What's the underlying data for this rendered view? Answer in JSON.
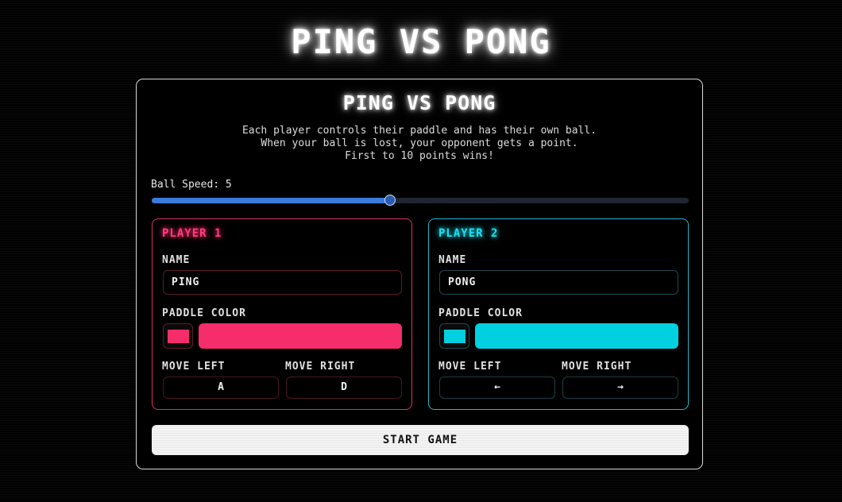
{
  "page_title": "PING VS PONG",
  "panel": {
    "title": "PING VS PONG",
    "instructions": [
      "Each player controls their paddle and has their own ball.",
      "When your ball is lost, your opponent gets a point.",
      "First to 10 points wins!"
    ]
  },
  "speed": {
    "label": "Ball Speed: 5",
    "value": 5,
    "min": 1,
    "max": 10,
    "fill_color": "#3a7bdc"
  },
  "player1": {
    "title": "PLAYER 1",
    "name_label": "NAME",
    "name_value": "PING",
    "paddle_color_label": "PADDLE COLOR",
    "paddle_color": "#f62d6b",
    "move_left_label": "MOVE LEFT",
    "move_right_label": "MOVE RIGHT",
    "left_key": "A",
    "right_key": "D",
    "accent": "#ff3d7f"
  },
  "player2": {
    "title": "PLAYER 2",
    "name_label": "NAME",
    "name_value": "PONG",
    "paddle_color_label": "PADDLE COLOR",
    "paddle_color": "#00d0e0",
    "move_left_label": "MOVE LEFT",
    "move_right_label": "MOVE RIGHT",
    "left_key": "←",
    "right_key": "→",
    "accent": "#19e0f0"
  },
  "start_button": "START GAME"
}
